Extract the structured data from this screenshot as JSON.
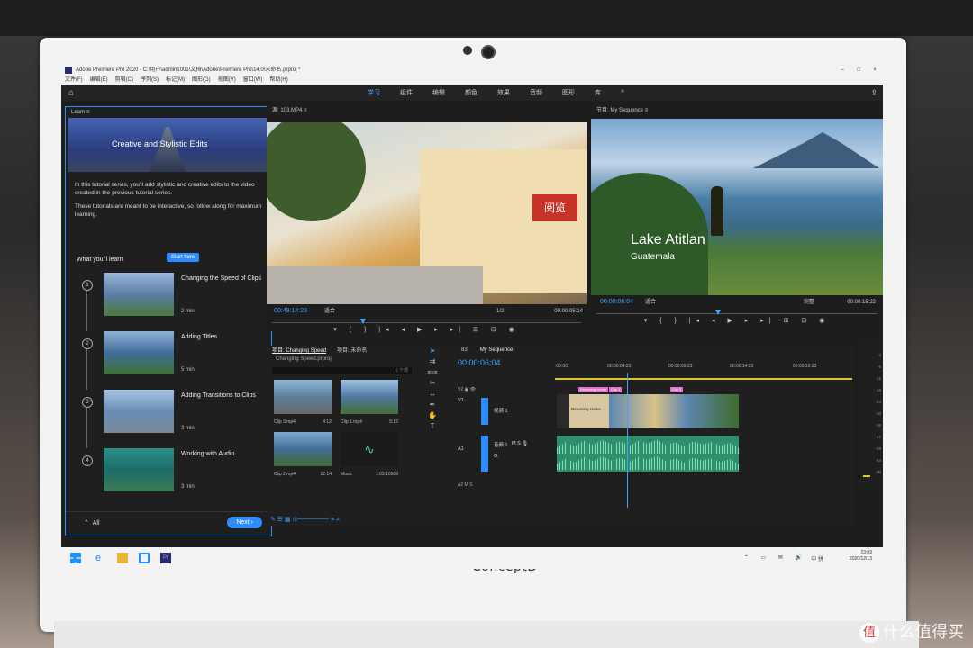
{
  "window": {
    "title": "Adobe Premiere Pro 2020 - C:\\用户\\admin1001\\文档\\Adobe\\Premiere Pro\\14.0\\未命名.prproj *",
    "controls": [
      "–",
      "□",
      "×"
    ]
  },
  "menu": [
    "文件(F)",
    "编辑(E)",
    "剪辑(C)",
    "序列(S)",
    "标记(M)",
    "图形(G)",
    "视图(V)",
    "窗口(W)",
    "帮助(H)"
  ],
  "workspaces": {
    "tabs": [
      "学习",
      "组件",
      "编辑",
      "颜色",
      "效果",
      "音频",
      "图形",
      "库",
      "»"
    ],
    "active": "学习"
  },
  "learn": {
    "panel_title": "Learn",
    "hero_title": "Creative and Stylistic Edits",
    "desc1": "In this tutorial series, you'll add stylistic and creative edits to the video created in the previous tutorial series.",
    "desc2": "These tutorials are meant to be interactive, so follow along for maximum learning.",
    "what_youll_learn": "What you'll learn",
    "start_here": "Start here",
    "lessons": [
      {
        "num": "1",
        "title": "Changing the Speed of Clips",
        "duration": "2 min"
      },
      {
        "num": "2",
        "title": "Adding Titles",
        "duration": "5 min"
      },
      {
        "num": "3",
        "title": "Adding Transitions to Clips",
        "duration": "3 min"
      },
      {
        "num": "4",
        "title": "Working with Audio",
        "duration": "3 min"
      }
    ],
    "all_label": "All",
    "next_label": "Next"
  },
  "source": {
    "panel_title": "源: 103.MP4",
    "timecode": "00:49:14:23",
    "fit": "适合",
    "resolution": "1/2",
    "duration": "00:00:05:14",
    "sign_text": "阅览"
  },
  "program": {
    "panel_title": "节目: My Sequence",
    "overlay_title": "Lake Atitlan",
    "overlay_subtitle": "Guatemala",
    "timecode": "00:00:06:04",
    "fit": "适合",
    "resolution": "完整",
    "duration": "00:00:15:22"
  },
  "project": {
    "tabs": [
      "项目: Changing Speed",
      "项目: 未命名"
    ],
    "file": "Changing Speed.prproj",
    "count": "6 个项",
    "clips": [
      {
        "name": "Clip 3.mp4",
        "dur": "4:12"
      },
      {
        "name": "Clip 1.mp4",
        "dur": "5:15"
      },
      {
        "name": "Clip 2.mp4",
        "dur": "12:14"
      },
      {
        "name": "Music",
        "dur": "1:03:10909"
      }
    ]
  },
  "timeline": {
    "tabs": [
      "83",
      "My Sequence"
    ],
    "timecode": "00:00:06:04",
    "ruler": [
      ":00:00",
      "00:00:04:23",
      "00:00:09:23",
      "00:00:14:23",
      "00:00:19:23"
    ],
    "tracks": {
      "v2": "V2",
      "v1": "V1",
      "v1_name": "视频 1",
      "a1": "A1",
      "a1_name": "音频 1",
      "a2": "A2"
    },
    "clip_label": "Returning Home",
    "fx_labels": [
      "Clip 1",
      "Clip 2"
    ]
  },
  "meter_scale": [
    "0",
    "-6",
    "-12",
    "-18",
    "-24",
    "-30",
    "-36",
    "-42",
    "-48",
    "-54",
    "dB"
  ],
  "taskbar": {
    "ime": "中",
    "ime2": "拼",
    "time": "23:09",
    "date": "2020/12/13"
  },
  "device": {
    "brand": "ConceptD",
    "watermark": "什么值得买"
  }
}
